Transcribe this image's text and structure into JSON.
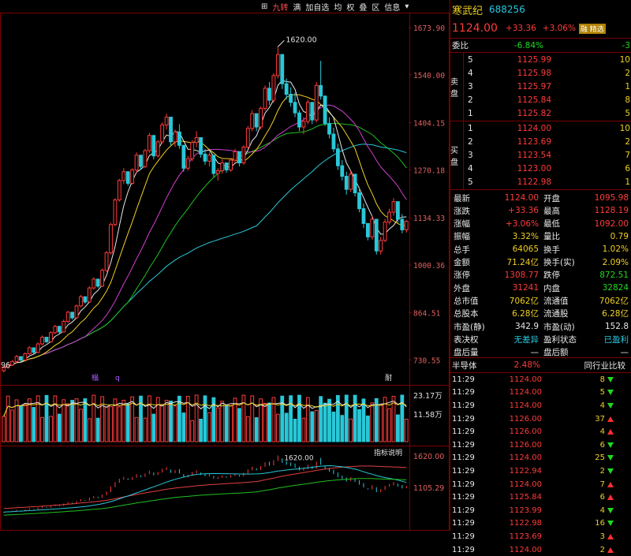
{
  "toolbar": {
    "items": [
      "⊞",
      "九转",
      "满",
      "加自选",
      "均",
      "权",
      "叠",
      "区",
      "信息",
      "▾"
    ]
  },
  "stock": {
    "name": "寒武纪",
    "code": "688256",
    "price": "1124.00",
    "change": "+33.36",
    "pct": "+3.06%",
    "badge": "融 精选"
  },
  "colors": {
    "up": "#ff3b3b",
    "down": "#20d820",
    "bg": "#000000",
    "border": "#7a0000",
    "ma5": "#e8e8e8",
    "ma10": "#f0d020",
    "ma20": "#d040d0",
    "ma60": "#20c020",
    "ma120": "#28c8d8"
  },
  "chart_data": [
    {
      "type": "candlestick",
      "price_axis": [
        "1673.90",
        "1540.00",
        "1404.15",
        "1270.18",
        "1134.33",
        "1000.36",
        "864.51",
        "730.55"
      ],
      "price_range": [
        700,
        1690
      ],
      "high_label": "1620.00",
      "low_label": "96",
      "marks": [
        "榻",
        "q",
        "耐"
      ],
      "x_labels": [],
      "candles": [
        [
          700,
          712,
          695,
          709
        ],
        [
          709,
          720,
          705,
          716
        ],
        [
          716,
          730,
          713,
          726
        ],
        [
          726,
          745,
          722,
          740
        ],
        [
          740,
          735,
          725,
          730
        ],
        [
          730,
          752,
          728,
          748
        ],
        [
          748,
          770,
          745,
          765
        ],
        [
          765,
          760,
          748,
          752
        ],
        [
          752,
          780,
          750,
          776
        ],
        [
          776,
          800,
          772,
          795
        ],
        [
          795,
          790,
          778,
          782
        ],
        [
          782,
          812,
          780,
          808
        ],
        [
          808,
          830,
          804,
          826
        ],
        [
          826,
          820,
          805,
          810
        ],
        [
          810,
          845,
          808,
          840
        ],
        [
          840,
          870,
          835,
          866
        ],
        [
          866,
          860,
          845,
          850
        ],
        [
          850,
          888,
          848,
          884
        ],
        [
          884,
          915,
          880,
          910
        ],
        [
          910,
          905,
          890,
          895
        ],
        [
          895,
          940,
          892,
          935
        ],
        [
          935,
          965,
          930,
          960
        ],
        [
          960,
          955,
          935,
          940
        ],
        [
          940,
          990,
          938,
          985
        ],
        [
          985,
          1040,
          980,
          1035
        ],
        [
          1035,
          1120,
          1030,
          1115
        ],
        [
          1115,
          1190,
          1110,
          1185
        ],
        [
          1185,
          1245,
          1180,
          1240
        ],
        [
          1240,
          1275,
          1230,
          1265
        ],
        [
          1265,
          1250,
          1225,
          1232
        ],
        [
          1232,
          1275,
          1228,
          1270
        ],
        [
          1270,
          1320,
          1262,
          1312
        ],
        [
          1312,
          1300,
          1270,
          1280
        ],
        [
          1280,
          1330,
          1275,
          1325
        ],
        [
          1325,
          1375,
          1318,
          1368
        ],
        [
          1368,
          1345,
          1300,
          1310
        ],
        [
          1310,
          1355,
          1305,
          1350
        ],
        [
          1350,
          1405,
          1345,
          1398
        ],
        [
          1398,
          1430,
          1385,
          1420
        ],
        [
          1420,
          1395,
          1340,
          1350
        ],
        [
          1350,
          1385,
          1335,
          1378
        ],
        [
          1378,
          1400,
          1330,
          1340
        ],
        [
          1340,
          1320,
          1265,
          1275
        ],
        [
          1275,
          1310,
          1268,
          1302
        ],
        [
          1302,
          1355,
          1295,
          1348
        ],
        [
          1348,
          1380,
          1335,
          1362
        ],
        [
          1362,
          1345,
          1305,
          1315
        ],
        [
          1315,
          1330,
          1285,
          1295
        ],
        [
          1295,
          1320,
          1280,
          1312
        ],
        [
          1312,
          1290,
          1250,
          1260
        ],
        [
          1260,
          1275,
          1240,
          1268
        ],
        [
          1268,
          1300,
          1260,
          1290
        ],
        [
          1290,
          1282,
          1262,
          1270
        ],
        [
          1270,
          1302,
          1265,
          1298
        ],
        [
          1298,
          1330,
          1292,
          1322
        ],
        [
          1322,
          1305,
          1280,
          1290
        ],
        [
          1290,
          1340,
          1285,
          1335
        ],
        [
          1335,
          1395,
          1330,
          1388
        ],
        [
          1388,
          1440,
          1380,
          1430
        ],
        [
          1430,
          1415,
          1380,
          1392
        ],
        [
          1392,
          1450,
          1385,
          1445
        ],
        [
          1445,
          1510,
          1438,
          1502
        ],
        [
          1502,
          1520,
          1455,
          1468
        ],
        [
          1468,
          1545,
          1460,
          1538
        ],
        [
          1538,
          1620,
          1530,
          1598
        ],
        [
          1598,
          1575,
          1500,
          1515
        ],
        [
          1515,
          1530,
          1470,
          1485
        ],
        [
          1485,
          1505,
          1450,
          1462
        ],
        [
          1462,
          1490,
          1420,
          1432
        ],
        [
          1432,
          1440,
          1380,
          1392
        ],
        [
          1392,
          1420,
          1372,
          1408
        ],
        [
          1408,
          1470,
          1400,
          1462
        ],
        [
          1462,
          1448,
          1400,
          1412
        ],
        [
          1412,
          1520,
          1405,
          1510
        ],
        [
          1510,
          1580,
          1470,
          1480
        ],
        [
          1480,
          1450,
          1395,
          1402
        ],
        [
          1402,
          1420,
          1360,
          1372
        ],
        [
          1372,
          1390,
          1320,
          1330
        ],
        [
          1330,
          1345,
          1270,
          1282
        ],
        [
          1282,
          1298,
          1240,
          1252
        ],
        [
          1252,
          1265,
          1200,
          1215
        ],
        [
          1215,
          1268,
          1208,
          1258
        ],
        [
          1258,
          1245,
          1195,
          1205
        ],
        [
          1205,
          1222,
          1150,
          1160
        ],
        [
          1160,
          1175,
          1105,
          1118
        ],
        [
          1118,
          1090,
          1070,
          1080
        ],
        [
          1080,
          1140,
          1072,
          1130
        ],
        [
          1130,
          1110,
          1030,
          1040
        ],
        [
          1040,
          1080,
          1030,
          1070
        ],
        [
          1070,
          1130,
          1065,
          1122
        ],
        [
          1122,
          1160,
          1115,
          1150
        ],
        [
          1150,
          1190,
          1140,
          1180
        ],
        [
          1180,
          1165,
          1120,
          1130
        ],
        [
          1130,
          1145,
          1090,
          1100
        ],
        [
          1100,
          1128,
          1092,
          1124
        ]
      ],
      "volume_axis": [
        "23.17万",
        "11.58万"
      ],
      "indicator_label": "指标说明",
      "indicator_axis": [
        "1620.00",
        "1105.29"
      ],
      "indicator_high_label": "1620.00"
    }
  ],
  "panel": {
    "weibi": {
      "label": "委比",
      "value": "-6.84%",
      "diff": "-3"
    },
    "sell": {
      "label": "卖盘",
      "rows": [
        {
          "lvl": "5",
          "price": "1125.99",
          "vol": "10"
        },
        {
          "lvl": "4",
          "price": "1125.98",
          "vol": "2"
        },
        {
          "lvl": "3",
          "price": "1125.97",
          "vol": "1"
        },
        {
          "lvl": "2",
          "price": "1125.84",
          "vol": "8"
        },
        {
          "lvl": "1",
          "price": "1125.82",
          "vol": "5"
        }
      ]
    },
    "buy": {
      "label": "买盘",
      "rows": [
        {
          "lvl": "1",
          "price": "1124.00",
          "vol": "10"
        },
        {
          "lvl": "2",
          "price": "1123.69",
          "vol": "2"
        },
        {
          "lvl": "3",
          "price": "1123.54",
          "vol": "7"
        },
        {
          "lvl": "4",
          "price": "1123.00",
          "vol": "6"
        },
        {
          "lvl": "5",
          "price": "1122.98",
          "vol": "1"
        }
      ]
    },
    "stats": [
      {
        "l1": "最新",
        "v1": "1124.00",
        "c1": "red",
        "l2": "开盘",
        "v2": "1095.98",
        "c2": "red"
      },
      {
        "l1": "涨跌",
        "v1": "+33.36",
        "c1": "red",
        "l2": "最高",
        "v2": "1128.19",
        "c2": "red"
      },
      {
        "l1": "涨幅",
        "v1": "+3.06%",
        "c1": "red",
        "l2": "最低",
        "v2": "1092.00",
        "c2": "red"
      },
      {
        "l1": "振幅",
        "v1": "3.32%",
        "c1": "yellow",
        "l2": "量比",
        "v2": "0.79",
        "c2": "yellow"
      },
      {
        "l1": "总手",
        "v1": "64065",
        "c1": "yellow",
        "l2": "换手",
        "v2": "1.02%",
        "c2": "yellow"
      },
      {
        "l1": "金额",
        "v1": "71.24亿",
        "c1": "yellow",
        "l2": "换手(实)",
        "v2": "2.09%",
        "c2": "yellow"
      },
      {
        "l1": "涨停",
        "v1": "1308.77",
        "c1": "red",
        "l2": "跌停",
        "v2": "872.51",
        "c2": "green"
      },
      {
        "l1": "外盘",
        "v1": "31241",
        "c1": "red",
        "l2": "内盘",
        "v2": "32824",
        "c2": "green"
      },
      {
        "l1": "总市值",
        "v1": "7062亿",
        "c1": "yellow",
        "l2": "流通值",
        "v2": "7062亿",
        "c2": "yellow"
      },
      {
        "l1": "总股本",
        "v1": "6.28亿",
        "c1": "yellow",
        "l2": "流通股",
        "v2": "6.28亿",
        "c2": "yellow"
      },
      {
        "l1": "市盈(静)",
        "v1": "342.9",
        "c1": "white",
        "l2": "市盈(动)",
        "v2": "152.8",
        "c2": "white"
      },
      {
        "l1": "表决权",
        "v1": "无差异",
        "c1": "cyan",
        "l2": "盈利状态",
        "v2": "已盈利",
        "c2": "cyan"
      },
      {
        "l1": "盘后量",
        "v1": "—",
        "c1": "white",
        "l2": "盘后额",
        "v2": "—",
        "c2": "white"
      }
    ],
    "sector": {
      "name": "半导体",
      "pct": "2.48%",
      "compare": "同行业比较"
    },
    "ticks": [
      {
        "time": "11:29",
        "price": "1124.00",
        "pc": "red",
        "vol": "8",
        "dir": "down"
      },
      {
        "time": "11:29",
        "price": "1124.00",
        "pc": "red",
        "vol": "5",
        "dir": "down"
      },
      {
        "time": "11:29",
        "price": "1124.00",
        "pc": "red",
        "vol": "4",
        "dir": "down"
      },
      {
        "time": "11:29",
        "price": "1126.00",
        "pc": "red",
        "vol": "37",
        "dir": "up"
      },
      {
        "time": "11:29",
        "price": "1126.00",
        "pc": "red",
        "vol": "4",
        "dir": "up"
      },
      {
        "time": "11:29",
        "price": "1126.00",
        "pc": "red",
        "vol": "6",
        "dir": "down"
      },
      {
        "time": "11:29",
        "price": "1124.00",
        "pc": "red",
        "vol": "25",
        "dir": "down"
      },
      {
        "time": "11:29",
        "price": "1122.94",
        "pc": "red",
        "vol": "2",
        "dir": "down"
      },
      {
        "time": "11:29",
        "price": "1124.00",
        "pc": "red",
        "vol": "7",
        "dir": "up"
      },
      {
        "time": "11:29",
        "price": "1125.84",
        "pc": "red",
        "vol": "6",
        "dir": "up"
      },
      {
        "time": "11:29",
        "price": "1123.99",
        "pc": "red",
        "vol": "4",
        "dir": "down"
      },
      {
        "time": "11:29",
        "price": "1122.98",
        "pc": "red",
        "vol": "16",
        "dir": "down"
      },
      {
        "time": "11:29",
        "price": "1123.69",
        "pc": "red",
        "vol": "3",
        "dir": "up"
      },
      {
        "time": "11:29",
        "price": "1124.00",
        "pc": "red",
        "vol": "2",
        "dir": "up"
      }
    ]
  }
}
